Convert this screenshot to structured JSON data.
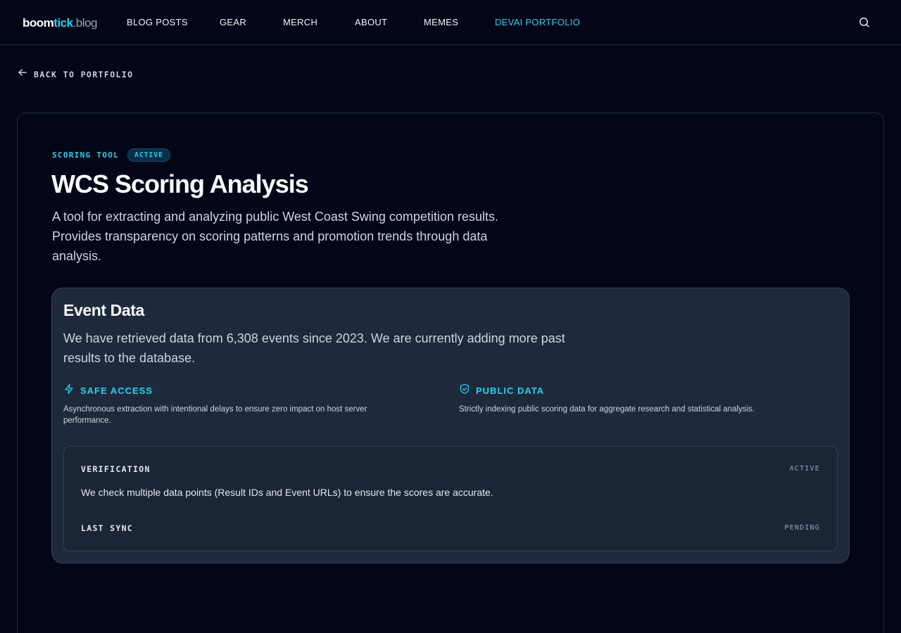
{
  "logo": {
    "part1": "boom",
    "part2": "tick",
    "part3": ".blog"
  },
  "nav": {
    "items": [
      {
        "label": "BLOG POSTS"
      },
      {
        "label": "GEAR"
      },
      {
        "label": "MERCH"
      },
      {
        "label": "ABOUT"
      },
      {
        "label": "MEMES"
      },
      {
        "label": "DEVAI PORTFOLIO"
      }
    ],
    "active_index": 5
  },
  "back_link": {
    "label": "BACK TO PORTFOLIO"
  },
  "project": {
    "category": "SCORING TOOL",
    "status_badge": "ACTIVE",
    "title": "WCS Scoring Analysis",
    "description": "A tool for extracting and analyzing public West Coast Swing competition results. Provides transparency on scoring patterns and promotion trends through data analysis."
  },
  "event_data": {
    "title": "Event Data",
    "description": "We have retrieved data from 6,308 events since 2023. We are currently adding more past results to the database.",
    "features": [
      {
        "icon": "lightning-icon",
        "title": "SAFE ACCESS",
        "text": "Asynchronous extraction with intentional delays to ensure zero impact on host server performance."
      },
      {
        "icon": "shield-check-icon",
        "title": "PUBLIC DATA",
        "text": "Strictly indexing public scoring data for aggregate research and statistical analysis."
      }
    ],
    "verification": {
      "label": "VERIFICATION",
      "status": "ACTIVE",
      "text": "We check multiple data points (Result IDs and Event URLs) to ensure the scores are accurate."
    },
    "last_sync": {
      "label": "LAST SYNC",
      "status": "PENDING"
    }
  },
  "colors": {
    "background": "#020617",
    "accent": "#22d3ee",
    "card": "#1e293b",
    "border": "#334155"
  }
}
